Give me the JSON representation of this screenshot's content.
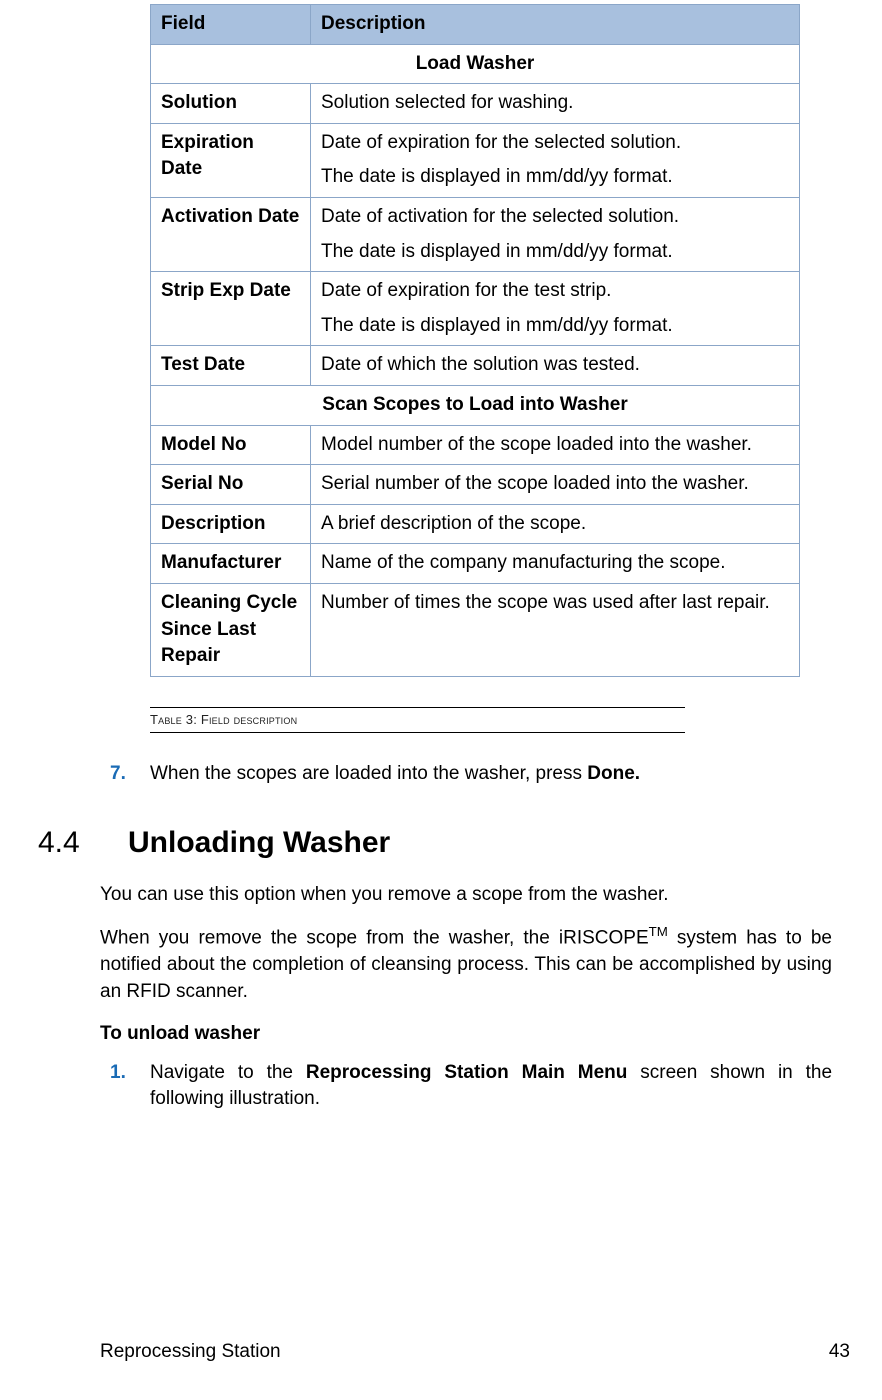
{
  "table": {
    "header": {
      "field": "Field",
      "desc": "Description"
    },
    "section1": "Load Washer",
    "rows1": [
      {
        "field": "Solution",
        "desc": "Solution selected for washing."
      },
      {
        "field": "Expiration Date",
        "desc1": "Date of expiration for the selected solution.",
        "desc2": "The date is displayed in mm/dd/yy format."
      },
      {
        "field": "Activation Date",
        "desc1": "Date of activation for the selected solution.",
        "desc2": "The date is displayed in mm/dd/yy format."
      },
      {
        "field": "Strip Exp Date",
        "desc1": "Date of expiration for the test strip.",
        "desc2": "The date is displayed in mm/dd/yy format."
      },
      {
        "field": "Test Date",
        "desc": "Date of which  the solution was tested."
      }
    ],
    "section2": "Scan Scopes to Load into Washer",
    "rows2": [
      {
        "field": "Model No",
        "desc": "Model number of the scope loaded into the washer."
      },
      {
        "field": "Serial No",
        "desc": "Serial number of the scope loaded into the washer."
      },
      {
        "field": "Description",
        "desc": "A brief description of the scope."
      },
      {
        "field": "Manufacturer",
        "desc": "Name of the company manufacturing the scope."
      },
      {
        "field": "Cleaning Cycle Since Last Repair",
        "desc": "Number of times the scope was used after last repair."
      }
    ]
  },
  "caption": "Table 3: Field description",
  "step7": {
    "number": "7.",
    "pre": "When the scopes are loaded into the washer, press ",
    "bold": "Done."
  },
  "section": {
    "number": "4.4",
    "title": "Unloading Washer"
  },
  "para1": "You can use this option when you remove a scope from the washer.",
  "para2_pre": "When you remove the scope from  the washer, the  iRISCOPE",
  "para2_tm": "TM",
  "para2_post": " system has to be notified about the completion of cleansing process. This can be accomplished by using an RFID scanner.",
  "subheading": "To unload washer",
  "step1": {
    "number": "1.",
    "pre": "Navigate to the ",
    "bold": "Reprocessing Station Main Menu",
    "post": " screen shown in the following illustration."
  },
  "footer": {
    "left": "Reprocessing Station",
    "right": "43"
  }
}
